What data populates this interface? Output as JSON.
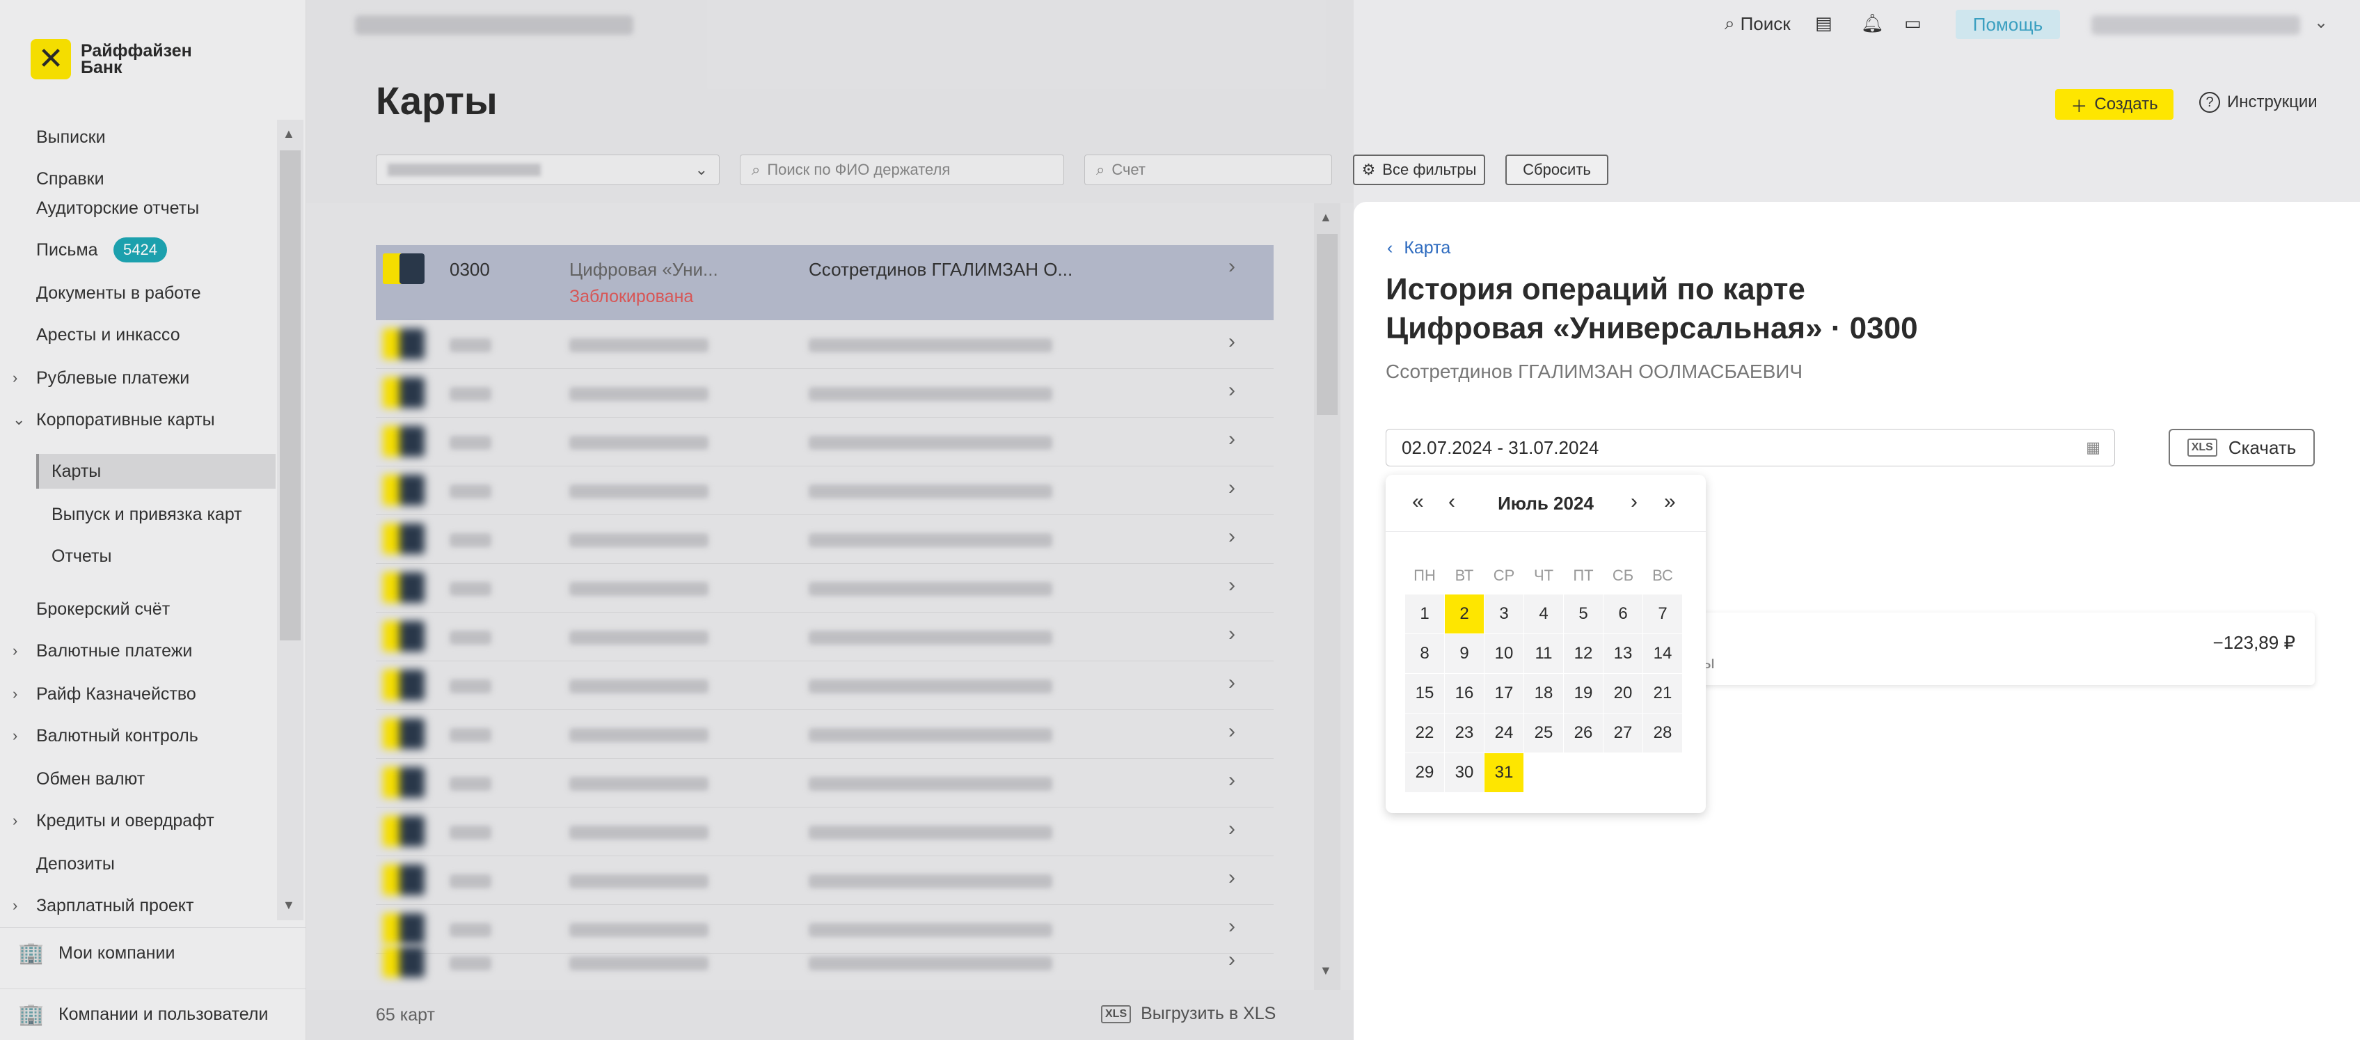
{
  "brand": {
    "name": "Райффайзен\nБанк"
  },
  "sidebar": {
    "items": [
      {
        "label": "Выписки"
      },
      {
        "label": "Справки"
      },
      {
        "label": "Аудиторские отчеты"
      },
      {
        "label": "Письма",
        "badge": "5424"
      },
      {
        "label": "Документы в работе"
      },
      {
        "label": "Аресты и инкассо"
      },
      {
        "label": "Рублевые платежи"
      },
      {
        "label": "Корпоративные карты"
      },
      {
        "label": "Карты"
      },
      {
        "label": "Выпуск и привязка карт"
      },
      {
        "label": "Отчеты"
      },
      {
        "label": "Брокерский счёт"
      },
      {
        "label": "Валютные платежи"
      },
      {
        "label": "Райф Казначейство"
      },
      {
        "label": "Валютный контроль"
      },
      {
        "label": "Обмен валют"
      },
      {
        "label": "Кредиты и овердрафт"
      },
      {
        "label": "Депозиты"
      },
      {
        "label": "Зарплатный проект"
      }
    ],
    "bottom": [
      {
        "label": "Мои компании"
      },
      {
        "label": "Компании и пользователи"
      }
    ]
  },
  "header": {
    "search_label": "Поиск",
    "help_label": "Помощь"
  },
  "page": {
    "title": "Карты",
    "create_label": "Создать",
    "instructions_label": "Инструкции"
  },
  "filters": {
    "fio_placeholder": "Поиск по ФИО держателя",
    "account_placeholder": "Счет",
    "all_filters_label": "Все фильтры",
    "reset_label": "Сбросить"
  },
  "list": {
    "selected": {
      "number": "0300",
      "type": "Цифровая «Уни...",
      "status": "Заблокирована",
      "holder": "Ссотретдинов ГГАЛИМЗАН О..."
    },
    "count": "65 карт",
    "export_label": "Выгрузить в XLS"
  },
  "panel": {
    "back_label": "Карта",
    "title_line1": "История операций по карте",
    "title_line2": "Цифровая «Универсальная» · 0300",
    "holder": "Ссотретдинов ГГАЛИМЗАН ООЛМАСБАЕВИЧ",
    "date_range": "02.07.2024 - 31.07.2024",
    "download_label": "Скачать",
    "operation": {
      "amount": "−123,89 ₽",
      "desc_visible": "азины"
    }
  },
  "calendar": {
    "month": "Июль 2024",
    "weekdays": [
      "ПН",
      "ВТ",
      "СР",
      "ЧТ",
      "ПТ",
      "СБ",
      "ВС"
    ],
    "days": [
      "1",
      "2",
      "3",
      "4",
      "5",
      "6",
      "7",
      "8",
      "9",
      "10",
      "11",
      "12",
      "13",
      "14",
      "15",
      "16",
      "17",
      "18",
      "19",
      "20",
      "21",
      "22",
      "23",
      "24",
      "25",
      "26",
      "27",
      "28",
      "29",
      "30",
      "31"
    ],
    "highlighted": [
      "2",
      "31"
    ]
  },
  "colors": {
    "accent": "#fee600",
    "link": "#2e6bbf",
    "danger": "#e05a5a",
    "badge": "#1ea7b5"
  }
}
